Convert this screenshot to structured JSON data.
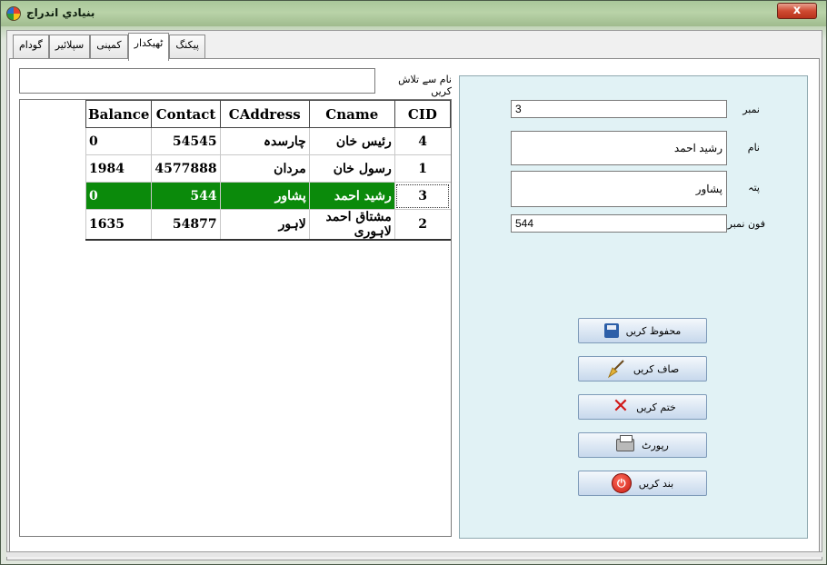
{
  "window": {
    "title": "بنيادي اندراج",
    "close_label": "x"
  },
  "tabs": [
    {
      "label": "پیکنگ"
    },
    {
      "label": "ٹھیکدار"
    },
    {
      "label": "کمپنی"
    },
    {
      "label": "سپلائیر"
    },
    {
      "label": "گودام"
    }
  ],
  "search": {
    "label": "نام سے تلاش کریں",
    "value": ""
  },
  "grid": {
    "columns": [
      "Balance",
      "Contact",
      "CAddress",
      "Cname",
      "CID"
    ],
    "rows": [
      {
        "balance": "0",
        "contact": "54545",
        "address": "چارسدہ",
        "cname": "رئیس خان",
        "cid": "4"
      },
      {
        "balance": "1984",
        "contact": "4577888",
        "address": "مردان",
        "cname": "رسول خان",
        "cid": "1"
      },
      {
        "balance": "0",
        "contact": "544",
        "address": "پشاور",
        "cname": "رشید احمد",
        "cid": "3"
      },
      {
        "balance": "1635",
        "contact": "54877",
        "address": "لاہور",
        "cname": "مشتاق احمد لاہوری",
        "cid": "2"
      }
    ]
  },
  "form": {
    "number_label": "نمبر",
    "number_value": "3",
    "name_label": "نام",
    "name_value": "رشید احمد",
    "address_label": "پتہ",
    "address_value": "پشاور",
    "phone_label": "فون نمبر",
    "phone_value": "544"
  },
  "buttons": {
    "save": "محفوظ کریں",
    "clear": "صاف کریں",
    "delete": "ختم کریں",
    "report": "رپورٹ",
    "close": "بند کریں"
  },
  "colors": {
    "selection": "#0b8a0b",
    "form_panel": "#e1f2f5"
  }
}
